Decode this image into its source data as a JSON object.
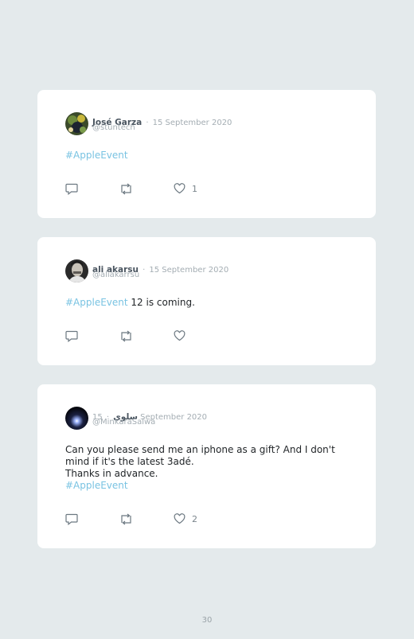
{
  "tweets": [
    {
      "name": "José Garza",
      "separator": "·",
      "date": "15 September 2020",
      "handle": "@stuntech",
      "text_before": "",
      "hashtag": "#AppleEvent",
      "text_after": "",
      "likes": "1"
    },
    {
      "name": "ali akarsu",
      "separator": "·",
      "date": "15 September 2020",
      "handle": "@aliakarrsu",
      "text_before": "",
      "hashtag": "#AppleEvent",
      "text_after": " 12 is coming.",
      "likes": ""
    },
    {
      "name": "سلوى",
      "separator": "·",
      "date": "15 September 2020",
      "handle": "@MinkaraSalwa",
      "text_before": "Can you please send me an iphone as a gift? And I don't mind if it's the latest 3adé.\nThanks in advance.\n",
      "hashtag": "#AppleEvent",
      "text_after": "",
      "likes": "2"
    }
  ],
  "page_number": "30",
  "colors": {
    "background": "#e4eaec",
    "card": "#ffffff",
    "hashtag": "#79c3e2",
    "meta": "#a4adb3",
    "icon": "#6b7780"
  },
  "icons": [
    "reply-icon",
    "retweet-icon",
    "like-icon"
  ]
}
